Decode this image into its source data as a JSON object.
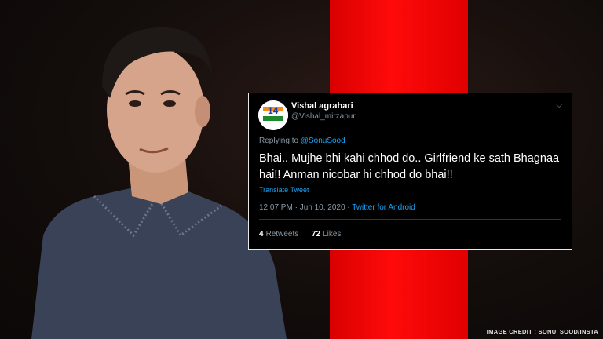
{
  "tweet": {
    "display_name": "Vishal agrahari",
    "handle": "@Vishal_mirzapur",
    "replying_prefix": "Replying to ",
    "replying_to": "@SonuSood",
    "text": "Bhai.. Mujhe bhi kahi chhod do.. Girlfriend ke sath Bhagnaa hai!! Anman nicobar hi chhod do bhai!!",
    "translate_label": "Translate Tweet",
    "timestamp": "12:07 PM · Jun 10, 2020 · ",
    "source": "Twitter for Android",
    "retweets_count": "4",
    "retweets_label": "Retweets",
    "likes_count": "72",
    "likes_label": "Likes",
    "menu_icon": "chevron-down-icon",
    "avatar_badge_text": "14"
  },
  "image_credit": "IMAGE CREDIT : SONU_SOOD/INSTA",
  "colors": {
    "accent_red": "#ff0a0a",
    "tweet_bg": "#000000",
    "link_blue": "#1da1f2",
    "muted_gray": "#8899a6"
  }
}
